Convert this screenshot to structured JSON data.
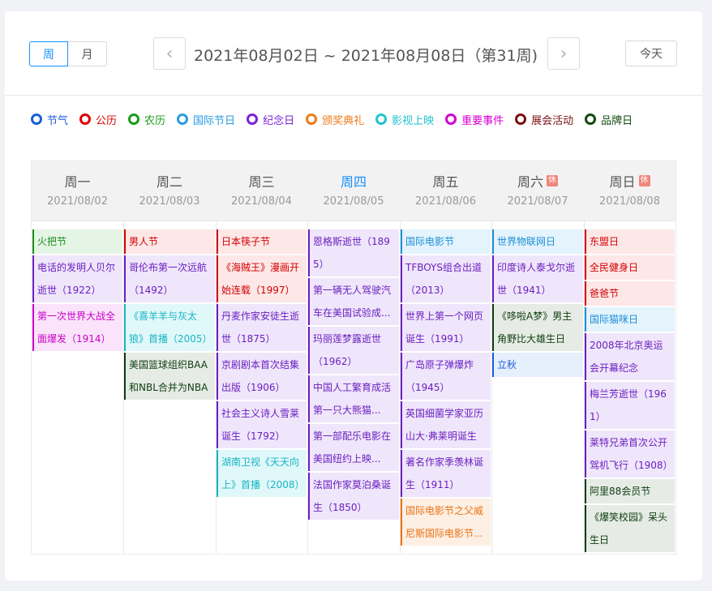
{
  "toolbar": {
    "week_label": "周",
    "month_label": "月",
    "prev_icon": "chevron-left",
    "next_icon": "chevron-right",
    "range_text": "2021年08月02日 ~ 2021年08月08日（第31周)",
    "today_label": "今天"
  },
  "legend": [
    {
      "label": "节气",
      "color": "#1a5ed8"
    },
    {
      "label": "公历",
      "color": "#e00000"
    },
    {
      "label": "农历",
      "color": "#1a9c1a"
    },
    {
      "label": "国际节日",
      "color": "#2a9be3"
    },
    {
      "label": "纪念日",
      "color": "#7b23d6"
    },
    {
      "label": "颁奖典礼",
      "color": "#ef7a1a"
    },
    {
      "label": "影视上映",
      "color": "#22c3cf"
    },
    {
      "label": "重要事件",
      "color": "#d400d4"
    },
    {
      "label": "展会活动",
      "color": "#7a1010"
    },
    {
      "label": "品牌日",
      "color": "#0d4a0d"
    }
  ],
  "days": [
    {
      "weekday": "周一",
      "date": "2021/08/02",
      "rest": "",
      "current": false
    },
    {
      "weekday": "周二",
      "date": "2021/08/03",
      "rest": "",
      "current": false
    },
    {
      "weekday": "周三",
      "date": "2021/08/04",
      "rest": "",
      "current": false
    },
    {
      "weekday": "周四",
      "date": "2021/08/05",
      "rest": "",
      "current": true
    },
    {
      "weekday": "周五",
      "date": "2021/08/06",
      "rest": "",
      "current": false
    },
    {
      "weekday": "周六",
      "date": "2021/08/07",
      "rest": "休",
      "current": false
    },
    {
      "weekday": "周日",
      "date": "2021/08/08",
      "rest": "休",
      "current": false
    }
  ],
  "events": [
    [
      {
        "text": "火把节",
        "category": 2
      },
      {
        "text": "电话的发明人贝尔逝世（1922）",
        "category": 4
      },
      {
        "text": "第一次世界大战全面爆发（1914）",
        "category": 7
      }
    ],
    [
      {
        "text": "男人节",
        "category": 1
      },
      {
        "text": "哥伦布第一次远航（1492）",
        "category": 4
      },
      {
        "text": "《喜羊羊与灰太狼》首播（2005）",
        "category": 6
      },
      {
        "text": "美国篮球组织BAA和NBL合并为NBA",
        "category": 9
      }
    ],
    [
      {
        "text": "日本筷子节",
        "category": 1
      },
      {
        "text": "《海贼王》漫画开始连载（1997）",
        "category": 1
      },
      {
        "text": "丹麦作家安徒生逝世（1875）",
        "category": 4
      },
      {
        "text": "京剧剧本首次结集出版（1906）",
        "category": 4
      },
      {
        "text": "社会主义诗人雪莱诞生（1792）",
        "category": 4
      },
      {
        "text": "湖南卫视《天天向上》首播（2008）",
        "category": 6
      }
    ],
    [
      {
        "text": "恩格斯逝世（1895）",
        "category": 4
      },
      {
        "text": "第一辆无人驾驶汽车在美国试验成...",
        "category": 4
      },
      {
        "text": "玛丽莲梦露逝世（1962）",
        "category": 4
      },
      {
        "text": "中国人工繁育成活第一只大熊猫...",
        "category": 4
      },
      {
        "text": "第一部配乐电影在美国纽约上映...",
        "category": 4
      },
      {
        "text": "法国作家莫泊桑诞生（1850）",
        "category": 4
      }
    ],
    [
      {
        "text": "国际电影节",
        "category": 3
      },
      {
        "text": "TFBOYS组合出道（2013）",
        "category": 4
      },
      {
        "text": "世界上第一个网页诞生（1991）",
        "category": 4
      },
      {
        "text": "广岛原子弹爆炸（1945）",
        "category": 4
      },
      {
        "text": "英国细菌学家亚历山大·弗莱明诞生",
        "category": 4
      },
      {
        "text": "著名作家季羡林诞生（1911）",
        "category": 4
      },
      {
        "text": "国际电影节之父威尼斯国际电影节...",
        "category": 5
      }
    ],
    [
      {
        "text": "世界物联网日",
        "category": 3
      },
      {
        "text": "印度诗人泰戈尔逝世（1941）",
        "category": 4
      },
      {
        "text": "《哆啦A梦》男主角野比大雄生日",
        "category": 9
      },
      {
        "text": "立秋",
        "category": 0
      }
    ],
    [
      {
        "text": "东盟日",
        "category": 1
      },
      {
        "text": "全民健身日",
        "category": 1
      },
      {
        "text": "爸爸节",
        "category": 1
      },
      {
        "text": "国际猫咪日",
        "category": 3
      },
      {
        "text": "2008年北京奥运会开幕纪念",
        "category": 4
      },
      {
        "text": "梅兰芳逝世（1961）",
        "category": 4
      },
      {
        "text": "莱特兄弟首次公开驾机飞行（1908）",
        "category": 4
      },
      {
        "text": "阿里88会员节",
        "category": 9
      },
      {
        "text": "《爆笑校园》呆头生日",
        "category": 9
      }
    ]
  ]
}
